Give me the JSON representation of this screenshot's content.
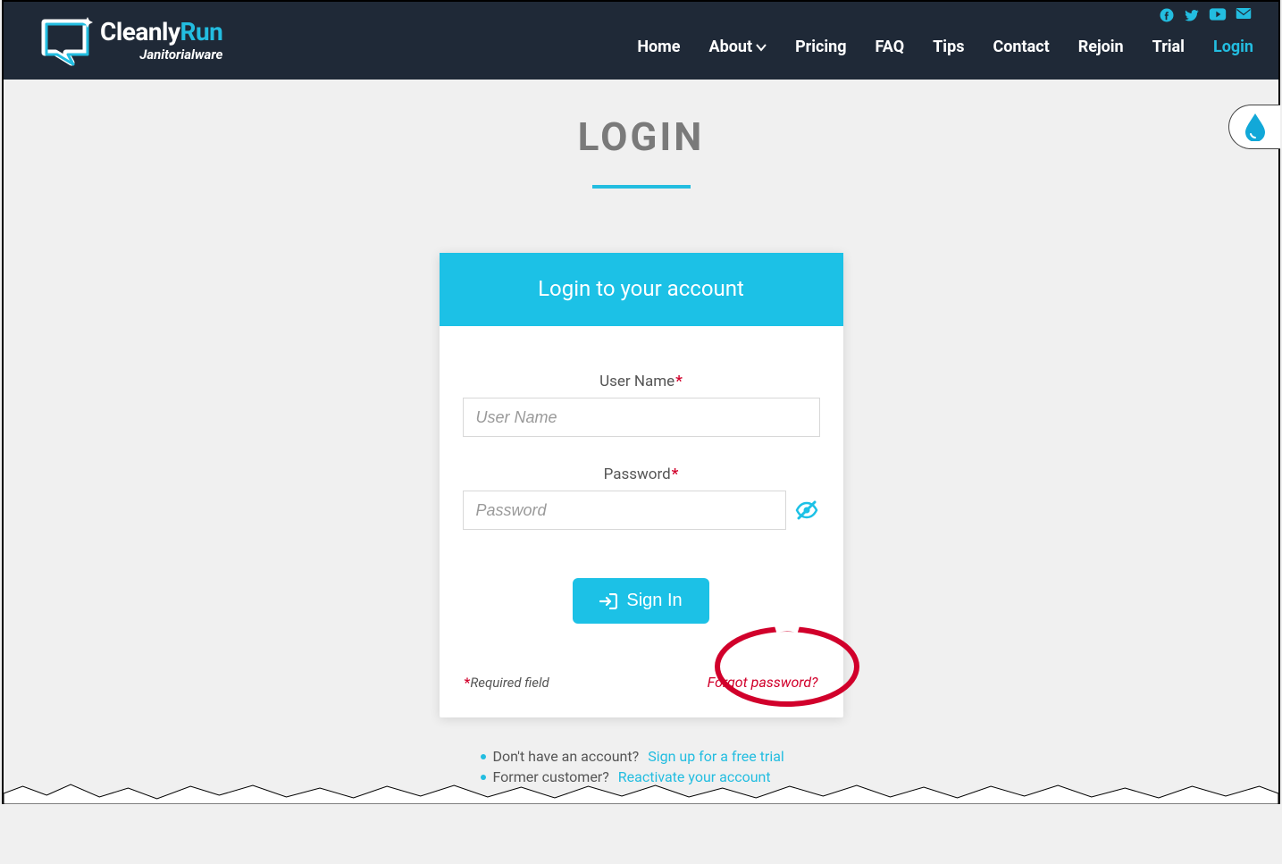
{
  "brand": {
    "part1": "Cleanly",
    "part2": "Run",
    "subtitle": "Janitorialware"
  },
  "nav": {
    "home": "Home",
    "about": "About",
    "pricing": "Pricing",
    "faq": "FAQ",
    "tips": "Tips",
    "contact": "Contact",
    "rejoin": "Rejoin",
    "trial": "Trial",
    "login": "Login"
  },
  "page": {
    "title": "LOGIN"
  },
  "card": {
    "header": "Login to your account",
    "username_label": "User Name",
    "username_placeholder": "User Name",
    "password_label": "Password",
    "password_placeholder": "Password",
    "signin_label": "Sign In",
    "required_note": "Required field",
    "forgot_label": "Forgot password?"
  },
  "below": {
    "line1_text": "Don't have an account?",
    "line1_link": "Sign up for a free trial",
    "line2_text": "Former customer?",
    "line2_link": "Reactivate your account"
  }
}
